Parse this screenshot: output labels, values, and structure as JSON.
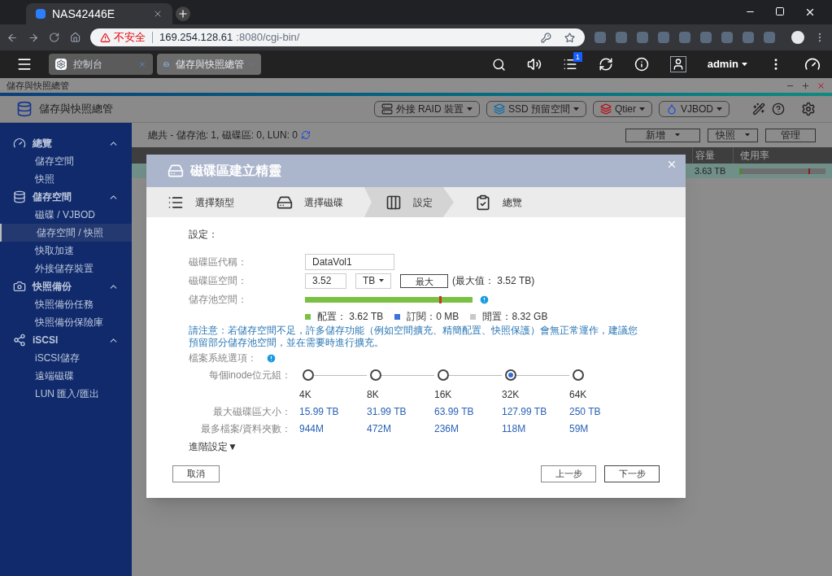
{
  "browser": {
    "tab_title": "NAS42446E",
    "security": "不安全",
    "host": "169.254.128.61",
    "path": ":8080/cgi-bin/"
  },
  "qts_tabs": [
    {
      "label": "控制台",
      "selected": false
    },
    {
      "label": "儲存與快照總管",
      "selected": true
    }
  ],
  "top_bar": {
    "notification_count": "1",
    "user": "admin"
  },
  "app": {
    "window_title": "儲存與快照總管",
    "title": "儲存與快照總管",
    "toolbar": [
      {
        "label": "外接 RAID 裝置",
        "kind": "raid"
      },
      {
        "label": "SSD 預留空間",
        "kind": "ssd"
      },
      {
        "label": "Qtier",
        "kind": "qtier"
      },
      {
        "label": "VJBOD",
        "kind": "vjbod"
      }
    ]
  },
  "sidebar": [
    {
      "label": "總覽",
      "kind": "overview",
      "expanded": true,
      "children": [
        {
          "label": "儲存空間",
          "selected": false
        },
        {
          "label": "快照",
          "selected": false
        }
      ]
    },
    {
      "label": "儲存空間",
      "kind": "storage",
      "expanded": true,
      "children": [
        {
          "label": "磁碟 / VJBOD",
          "selected": false
        },
        {
          "label": "儲存空間 / 快照",
          "selected": true
        },
        {
          "label": "快取加速",
          "selected": false
        },
        {
          "label": "外接儲存裝置",
          "selected": false
        }
      ]
    },
    {
      "label": "快照備份",
      "kind": "snapshot",
      "expanded": true,
      "children": [
        {
          "label": "快照備份任務",
          "selected": false
        },
        {
          "label": "快照備份保險庫",
          "selected": false
        }
      ]
    },
    {
      "label": "iSCSI",
      "kind": "iscsi",
      "expanded": true,
      "children": [
        {
          "label": "iSCSI儲存",
          "selected": false
        },
        {
          "label": "遠端磁碟",
          "selected": false
        },
        {
          "label": "LUN 匯入/匯出",
          "selected": false
        }
      ]
    }
  ],
  "summary": "總共 - 儲存池: 1, 磁碟區: 0, LUN: 0",
  "actions": [
    {
      "label": "新增",
      "dropdown": true
    },
    {
      "label": "快照",
      "dropdown": true
    },
    {
      "label": "管理",
      "dropdown": false
    }
  ],
  "table": {
    "columns": [
      "容量",
      "使用率"
    ],
    "rows": [
      {
        "capacity": "3.63 TB",
        "level": 0.03
      }
    ]
  },
  "wizard": {
    "title": "磁碟區建立精靈",
    "steps": [
      {
        "label": "選擇類型",
        "kind": "list",
        "selected": false
      },
      {
        "label": "選擇磁碟",
        "kind": "disk",
        "selected": false
      },
      {
        "label": "設定",
        "kind": "settings",
        "selected": true
      },
      {
        "label": "總覽",
        "kind": "summary",
        "selected": false
      }
    ],
    "section": "設定：",
    "name_label": "磁碟區代稱：",
    "name_value": "DataVol1",
    "size_label": "磁碟區空間：",
    "size_value": "3.52",
    "unit": "TB",
    "max_button": "最大",
    "max_note": "(最大值： 3.52 TB)",
    "pool_label": "儲存池空間：",
    "pool_bar": {
      "level": 0.8
    },
    "legend": [
      {
        "label": "配置： 3.62 TB",
        "color": "#7ac143"
      },
      {
        "label": "訂閱：0 MB",
        "color": "#3b73d9"
      },
      {
        "label": "閒置：8.32 GB",
        "color": "#c8c8c8"
      }
    ],
    "note": "請注意：若儲存空間不足，許多儲存功能（例如空間擴充、精簡配置、快照保護）會無正常運作，建議您預留部分儲存池空間，並在需要時進行擴充。",
    "fs_label": "檔案系統選項：",
    "inode_label": "每個inode位元組：",
    "max_volume_label": "最大磁碟區大小：",
    "max_files_label": "最多檔案/資料夾數：",
    "inode_options": [
      {
        "size": "4K",
        "max_volume": "15.99 TB",
        "max_files": "944M",
        "selected": false
      },
      {
        "size": "8K",
        "max_volume": "31.99 TB",
        "max_files": "472M",
        "selected": false
      },
      {
        "size": "16K",
        "max_volume": "63.99 TB",
        "max_files": "236M",
        "selected": false
      },
      {
        "size": "32K",
        "max_volume": "127.99 TB",
        "max_files": "118M",
        "selected": true
      },
      {
        "size": "64K",
        "max_volume": "250 TB",
        "max_files": "59M",
        "selected": false
      }
    ],
    "advanced": "進階設定▼",
    "cancel": "取消",
    "back": "上一步",
    "next": "下一步"
  }
}
